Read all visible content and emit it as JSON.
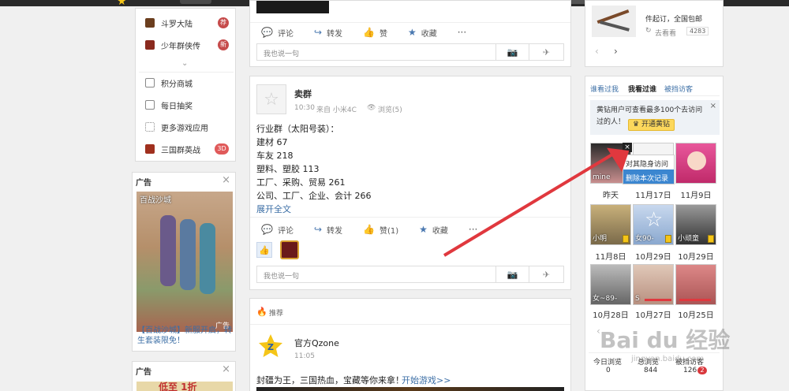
{
  "left_menu": {
    "items": [
      {
        "label": "斗罗大陆",
        "badge": "荐",
        "icon": "game-icon-douluo"
      },
      {
        "label": "少年群侠传",
        "badge": "新",
        "icon": "game-icon-shaonian"
      },
      {
        "label": "积分商城",
        "badge": "",
        "icon": "shop-icon"
      },
      {
        "label": "每日抽奖",
        "badge": "",
        "icon": "gift-icon"
      },
      {
        "label": "更多游戏应用",
        "badge": "",
        "icon": "grid-icon"
      },
      {
        "label": "三国群英战",
        "badge": "3D",
        "icon": "game-icon-sanguo"
      }
    ],
    "expand_icon": "chevron-down-icon"
  },
  "ad1": {
    "title": "广告",
    "image_caption": "百战沙城",
    "corner_label": "广告",
    "text": "【百战沙城】新服开启，转生套装限免！"
  },
  "ad2": {
    "title": "广告",
    "banner_text": "低至 1折"
  },
  "post1": {
    "actions": [
      "评论",
      "转发",
      "赞",
      "收藏"
    ],
    "reply_placeholder": "我也说一句"
  },
  "post2": {
    "author": "卖群",
    "time": "10:30",
    "source": "来自 小米4C",
    "views": "浏览(5)",
    "lines": [
      "行业群（太阳号装）：",
      "建材 67",
      "车友 218",
      "塑料、塑胶 113",
      "工厂、采购、贸易 261",
      "公司、工厂、企业、会计 266"
    ],
    "expand": "展开全文",
    "actions": [
      "评论",
      "转发",
      "赞(1)",
      "收藏"
    ],
    "reply_placeholder": "我也说一句"
  },
  "recommend": {
    "header": "推荐",
    "author": "官方Qzone",
    "time": "11:05",
    "text": "封疆为王，三国热血，宝藏等你来拿！",
    "link": "开始游戏>>"
  },
  "right_top": {
    "product_line1": "件起订，全国包邮",
    "product_line2": "去看看",
    "count": "4283"
  },
  "visitors": {
    "tabs": [
      "谁看过我",
      "我看过谁",
      "被挡访客"
    ],
    "active_tab": 1,
    "promo_text": "黄钻用户可查看最多100个去访问过的人！",
    "promo_button": "开通黄钻",
    "context_menu": [
      "对其隐身访问",
      "删除本次记录"
    ],
    "grid": [
      {
        "name": "mine",
        "date": "昨天",
        "color": "#c98f8f"
      },
      {
        "name": "",
        "date": "11月17日",
        "color": "#e8e8e8"
      },
      {
        "name": "",
        "date": "11月9日",
        "color": "#e8579b"
      },
      {
        "name": "小明",
        "date": "11月8日",
        "color": "#b09a6a"
      },
      {
        "name": "女90-",
        "date": "10月29日",
        "color": "#a9c0df"
      },
      {
        "name": "小顽童",
        "date": "10月29日",
        "color": "#555555"
      },
      {
        "name": "女~89-",
        "date": "10月28日",
        "color": "#8a8a8a"
      },
      {
        "name": "S",
        "date": "10月27日",
        "color": "#d8b8a8"
      },
      {
        "name": "",
        "date": "10月25日",
        "color": "#c77"
      }
    ],
    "stats": [
      {
        "label": "今日浏览",
        "value": "0"
      },
      {
        "label": "总浏览",
        "value": "844"
      },
      {
        "label": "被挡访客",
        "value": "126",
        "badge": "2"
      }
    ]
  },
  "watermark": "Bai du 经验",
  "watermark_url": "jingyan.baidu.com"
}
